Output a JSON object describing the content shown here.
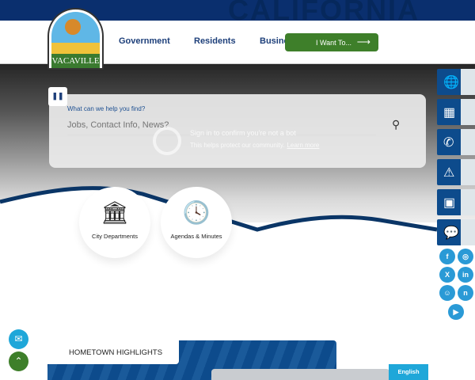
{
  "topbar": {
    "watermark": "CALIFORNIA"
  },
  "logo": {
    "name": "VACAVILLE"
  },
  "nav": {
    "items": [
      "Government",
      "Residents",
      "Business"
    ],
    "cta": "I Want To...",
    "cta_arrow": "⟶"
  },
  "hero": {
    "pause": "❚❚"
  },
  "search": {
    "label": "What can we help you find?",
    "placeholder": "Jobs, Contact Info, News?",
    "icon": "⚲"
  },
  "bot_overlay": {
    "title": "Sign in to confirm you're not a bot",
    "text": "This helps protect our community.",
    "link": "Learn more"
  },
  "quick_links": [
    {
      "label": "City Departments",
      "icon": "🏛"
    },
    {
      "label": "Agendas & Minutes",
      "icon": "🕓"
    }
  ],
  "side_buttons": [
    "news-icon",
    "calendar-icon",
    "contact-icon",
    "alert-icon",
    "bus-icon",
    "feedback-icon"
  ],
  "social": [
    "facebook",
    "instagram",
    "x",
    "linkedin",
    "app",
    "nextdoor",
    "youtube"
  ],
  "floating": {
    "email": "✉",
    "top": "⌃"
  },
  "highlights": {
    "title": "HOMETOWN HIGHLIGHTS"
  },
  "language": {
    "label": "English"
  },
  "colors": {
    "navy": "#0a2f6e",
    "green": "#3e7f2a",
    "blue": "#0d4b8c",
    "social": "#2a9ad6"
  }
}
